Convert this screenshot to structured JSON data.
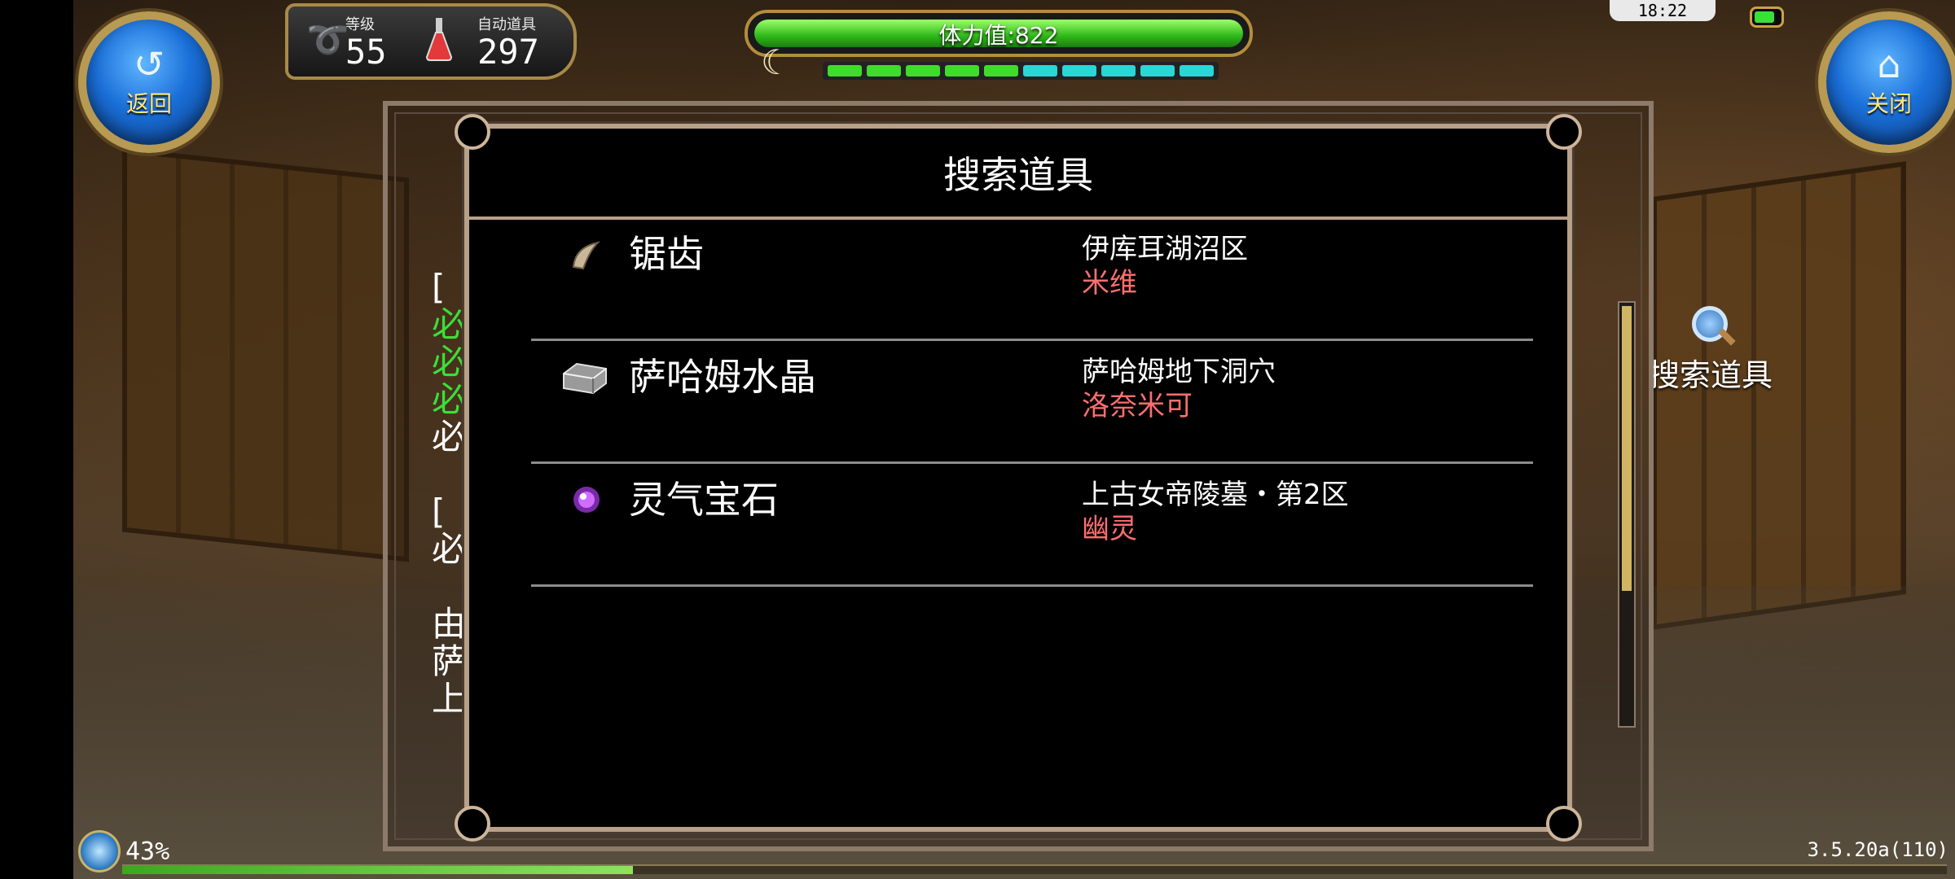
{
  "hud": {
    "back_label": "返回",
    "close_label": "关闭",
    "level_caption": "等级",
    "level_value": "55",
    "auto_items_caption": "自动道具",
    "auto_items_value": "297",
    "hp_text": "体力值:822",
    "hp_fraction": 1.0,
    "stamina_segments": [
      "#3fdc2b",
      "#3fdc2b",
      "#3fdc2b",
      "#3fdc2b",
      "#3fdc2b",
      "#2ad6d6",
      "#2ad6d6",
      "#2ad6d6",
      "#2ad6d6",
      "#2ad6d6"
    ],
    "clock": "18:22",
    "side_search_label": "搜索道具",
    "bottom_percent": "43%",
    "exp_fraction": 0.28,
    "version": "3.5.20a(110)"
  },
  "log": {
    "lines": [
      {
        "text": "[",
        "color": "#ffffff"
      },
      {
        "text": "必",
        "color": "#39e039"
      },
      {
        "text": "必",
        "color": "#39e039"
      },
      {
        "text": "必",
        "color": "#39e039"
      },
      {
        "text": "必",
        "color": "#ffffff"
      },
      {
        "text": "",
        "color": "#ffffff"
      },
      {
        "text": "[",
        "color": "#ffffff"
      },
      {
        "text": "必",
        "color": "#ffffff"
      },
      {
        "text": "",
        "color": "#ffffff"
      },
      {
        "text": "由",
        "color": "#ffffff"
      },
      {
        "text": "萨",
        "color": "#ffffff"
      },
      {
        "text": "上",
        "color": "#ffffff"
      }
    ]
  },
  "panel": {
    "title": "搜索道具",
    "items": [
      {
        "name": "锯齿",
        "location": "伊库耳湖沼区",
        "npc": "米维",
        "icon": "fang-icon"
      },
      {
        "name": "萨哈姆水晶",
        "location": "萨哈姆地下洞穴",
        "npc": "洛奈米可",
        "icon": "crystal-ingot-icon"
      },
      {
        "name": "灵气宝石",
        "location": "上古女帝陵墓・第2区",
        "npc": "幽灵",
        "icon": "aura-gem-icon"
      }
    ]
  }
}
